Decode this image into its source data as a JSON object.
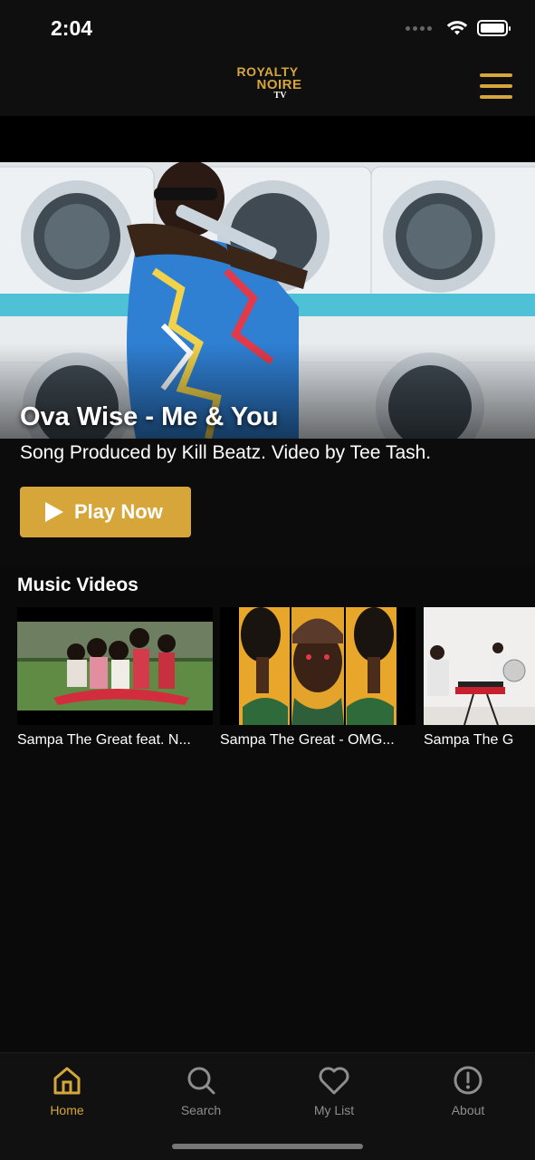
{
  "status": {
    "time": "2:04"
  },
  "header": {
    "logo_line1": "ROYALTY",
    "logo_line2": "NOIRE",
    "logo_line3": "TV",
    "menu_icon": "hamburger-menu-icon"
  },
  "hero": {
    "title": "Ova Wise - Me & You",
    "subtitle": "Song Produced by Kill Beatz. Video by Tee Tash.",
    "play_label": "Play Now"
  },
  "section": {
    "title": "Music Videos",
    "items": [
      {
        "caption": "Sampa The Great feat. N..."
      },
      {
        "caption": "Sampa The Great - OMG..."
      },
      {
        "caption": "Sampa The G"
      }
    ]
  },
  "tabs": [
    {
      "label": "Home",
      "icon": "home-icon",
      "active": true
    },
    {
      "label": "Search",
      "icon": "search-icon",
      "active": false
    },
    {
      "label": "My List",
      "icon": "heart-icon",
      "active": false
    },
    {
      "label": "About",
      "icon": "info-icon",
      "active": false
    }
  ],
  "colors": {
    "accent": "#d7a63a",
    "background": "#0a0a0a",
    "inactive": "#8e8e8e"
  }
}
